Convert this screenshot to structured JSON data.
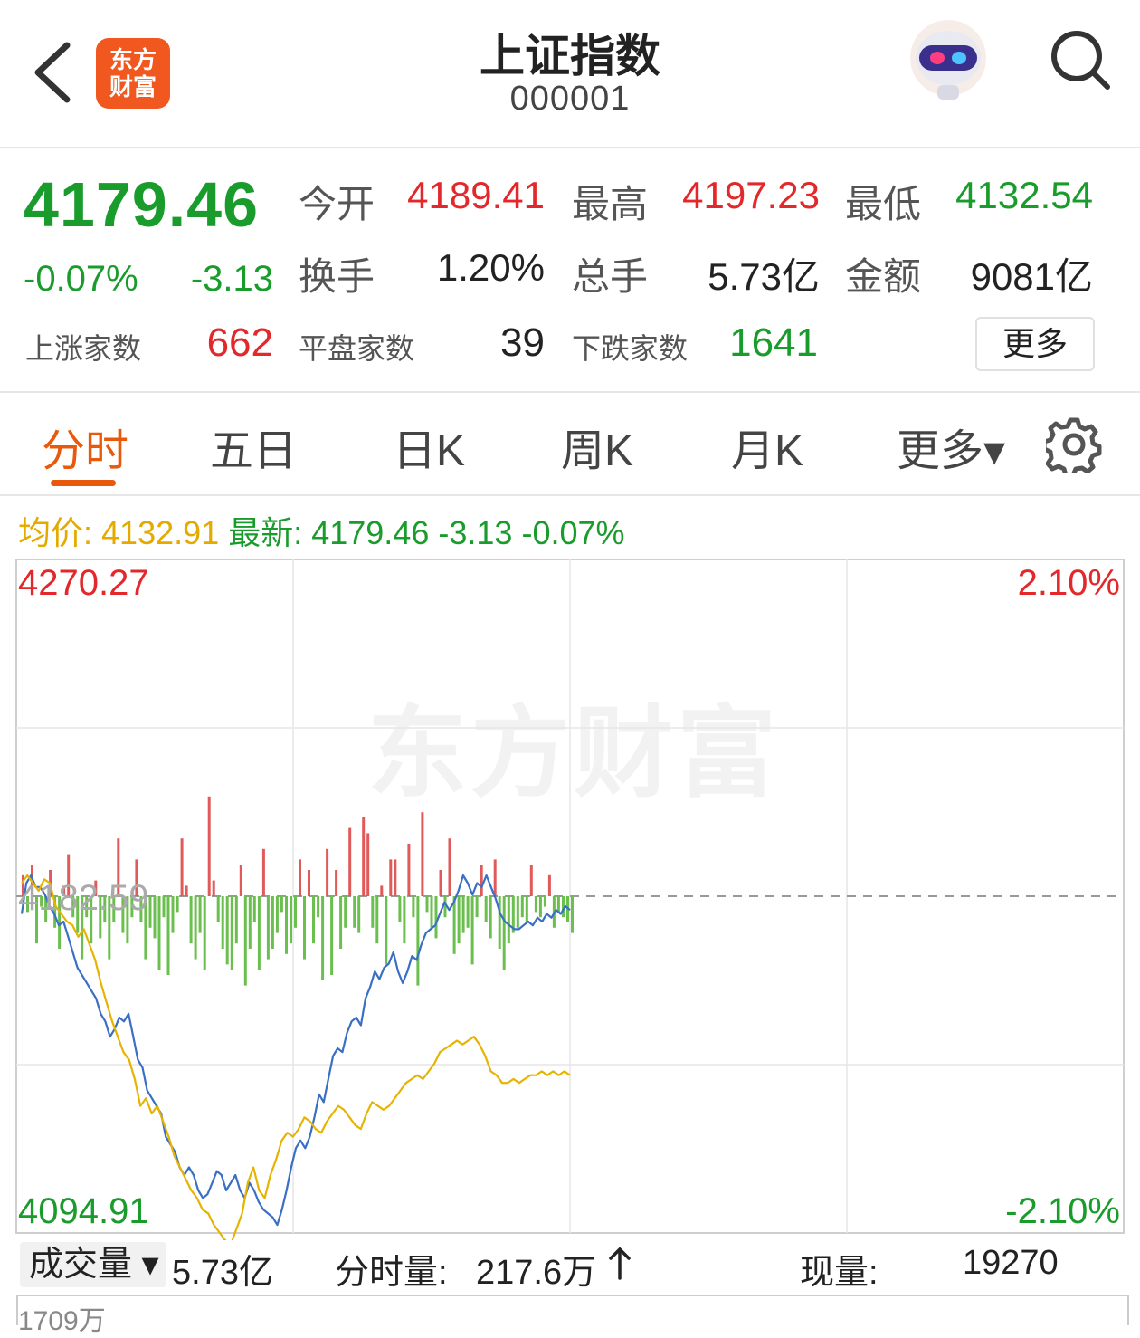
{
  "header": {
    "title": "上证指数",
    "code": "000001",
    "logo_line1": "东方",
    "logo_line2": "财富"
  },
  "quote": {
    "price": "4179.46",
    "change_pct": "-0.07%",
    "change": "-3.13",
    "open_label": "今开",
    "open": "4189.41",
    "high_label": "最高",
    "high": "4197.23",
    "low_label": "最低",
    "low": "4132.54",
    "turnover_label": "换手",
    "turnover": "1.20%",
    "volume_label": "总手",
    "volume": "5.73亿",
    "amount_label": "金额",
    "amount": "9081亿",
    "up_label": "上涨家数",
    "up": "662",
    "flat_label": "平盘家数",
    "flat": "39",
    "down_label": "下跌家数",
    "down": "1641",
    "more_label": "更多"
  },
  "tabs": [
    {
      "label": "分时",
      "active": true
    },
    {
      "label": "五日"
    },
    {
      "label": "日K"
    },
    {
      "label": "周K"
    },
    {
      "label": "月K"
    },
    {
      "label": "更多▾"
    }
  ],
  "avg_bar": {
    "avg_label": "均价:",
    "avg": "4132.91",
    "last_label": "最新:",
    "last": "4179.46",
    "last_change": "-3.13",
    "last_pct": "-0.07%"
  },
  "chart_data": {
    "type": "line",
    "y_top": "4270.27",
    "y_bottom": "4094.91",
    "pct_top": "2.10%",
    "pct_bottom": "-2.10%",
    "prev_close": "4182.59",
    "ylim": [
      4094.91,
      4270.27
    ],
    "session_minutes": 240,
    "series": [
      {
        "color": "#3a6fc4",
        "values": [
          4178,
          4186,
          4188,
          4185,
          4185,
          4183,
          4180,
          4178,
          4175,
          4176,
          4172,
          4168,
          4164,
          4162,
          4160,
          4158,
          4156,
          4152,
          4150,
          4146,
          4148,
          4151,
          4150,
          4152,
          4146,
          4140,
          4138,
          4132,
          4130,
          4128,
          4126,
          4120,
          4118,
          4116,
          4112,
          4110,
          4112,
          4110,
          4106,
          4104,
          4105,
          4108,
          4111,
          4110,
          4106,
          4108,
          4110,
          4106,
          4104,
          4108,
          4106,
          4103,
          4101,
          4100,
          4099,
          4097,
          4101,
          4106,
          4112,
          4117,
          4119,
          4117,
          4120,
          4125,
          4131,
          4129,
          4135,
          4141,
          4143,
          4142,
          4147,
          4150,
          4151,
          4149,
          4156,
          4159,
          4163,
          4161,
          4164,
          4165,
          4168,
          4163,
          4160,
          4163,
          4167,
          4166,
          4170,
          4173,
          4174,
          4175,
          4178,
          4181,
          4179,
          4181,
          4184,
          4188,
          4186,
          4183,
          4186,
          4185,
          4188,
          4185,
          4182,
          4178,
          4176,
          4175,
          4174,
          4174,
          4175,
          4176,
          4175,
          4177,
          4176,
          4178,
          4177,
          4179,
          4178,
          4180,
          4179
        ]
      },
      {
        "color": "#e6b400",
        "values": [
          4186,
          4188,
          4186,
          4184,
          4187,
          4186,
          4180,
          4178,
          4176,
          4175,
          4172,
          4174,
          4170,
          4166,
          4160,
          4155,
          4150,
          4146,
          4142,
          4140,
          4135,
          4128,
          4130,
          4126,
          4128,
          4124,
          4120,
          4115,
          4112,
          4109,
          4106,
          4104,
          4101,
          4100,
          4097,
          4095,
          4093,
          4092,
          4096,
          4100,
          4108,
          4112,
          4106,
          4104,
          4110,
          4114,
          4119,
          4121,
          4120,
          4122,
          4125,
          4124,
          4122,
          4121,
          4124,
          4126,
          4128,
          4127,
          4125,
          4123,
          4122,
          4126,
          4129,
          4128,
          4127,
          4128,
          4130,
          4132,
          4134,
          4135,
          4136,
          4135,
          4137,
          4139,
          4142,
          4143,
          4144,
          4145,
          4144,
          4145,
          4146,
          4144,
          4141,
          4137,
          4136,
          4134,
          4134,
          4135,
          4134,
          4135,
          4136,
          4136,
          4137,
          4136,
          4137,
          4136,
          4137,
          4136
        ]
      }
    ],
    "indicator_bars": [
      8,
      -6,
      12,
      -18,
      -4,
      -10,
      10,
      -12,
      -20,
      4,
      16,
      -8,
      -14,
      -24,
      -8,
      -18,
      6,
      -16,
      -10,
      -24,
      -10,
      22,
      -14,
      -18,
      -8,
      14,
      -10,
      -24,
      -12,
      -16,
      -28,
      -8,
      -30,
      -14,
      -6,
      22,
      4,
      -18,
      -24,
      -14,
      -28,
      38,
      6,
      -10,
      -20,
      -26,
      -28,
      -18,
      12,
      -34,
      -20,
      -10,
      -28,
      18,
      -24,
      -20,
      -14,
      -6,
      -22,
      -18,
      -12,
      14,
      -24,
      10,
      -18,
      -8,
      -32,
      18,
      -30,
      10,
      -20,
      -12,
      26,
      -12,
      -14,
      30,
      24,
      -12,
      -18,
      4,
      -26,
      14,
      14,
      -10,
      -18,
      20,
      -8,
      -34,
      32,
      -6,
      -12,
      -16,
      10,
      -8,
      22,
      -22,
      -18,
      -14,
      -12,
      -26,
      -8,
      12,
      -10,
      -16,
      14,
      -20,
      -28,
      -18,
      -14,
      -12,
      -8,
      -10,
      12,
      -6,
      -8,
      -4,
      8,
      -12,
      -6,
      -8,
      -10,
      -14
    ]
  },
  "volume_bar": {
    "selector": "成交量 ▾",
    "total": "5.73亿",
    "minute_label": "分时量:",
    "minute_value": "217.6万",
    "current_label": "现量:",
    "current_value": "19270",
    "vol_ytop": "1709万"
  },
  "watermark": "东方财富",
  "colors": {
    "up": "#e3282c",
    "down": "#1a9c2c",
    "accent": "#e8590c",
    "avg": "#e4aa00"
  }
}
